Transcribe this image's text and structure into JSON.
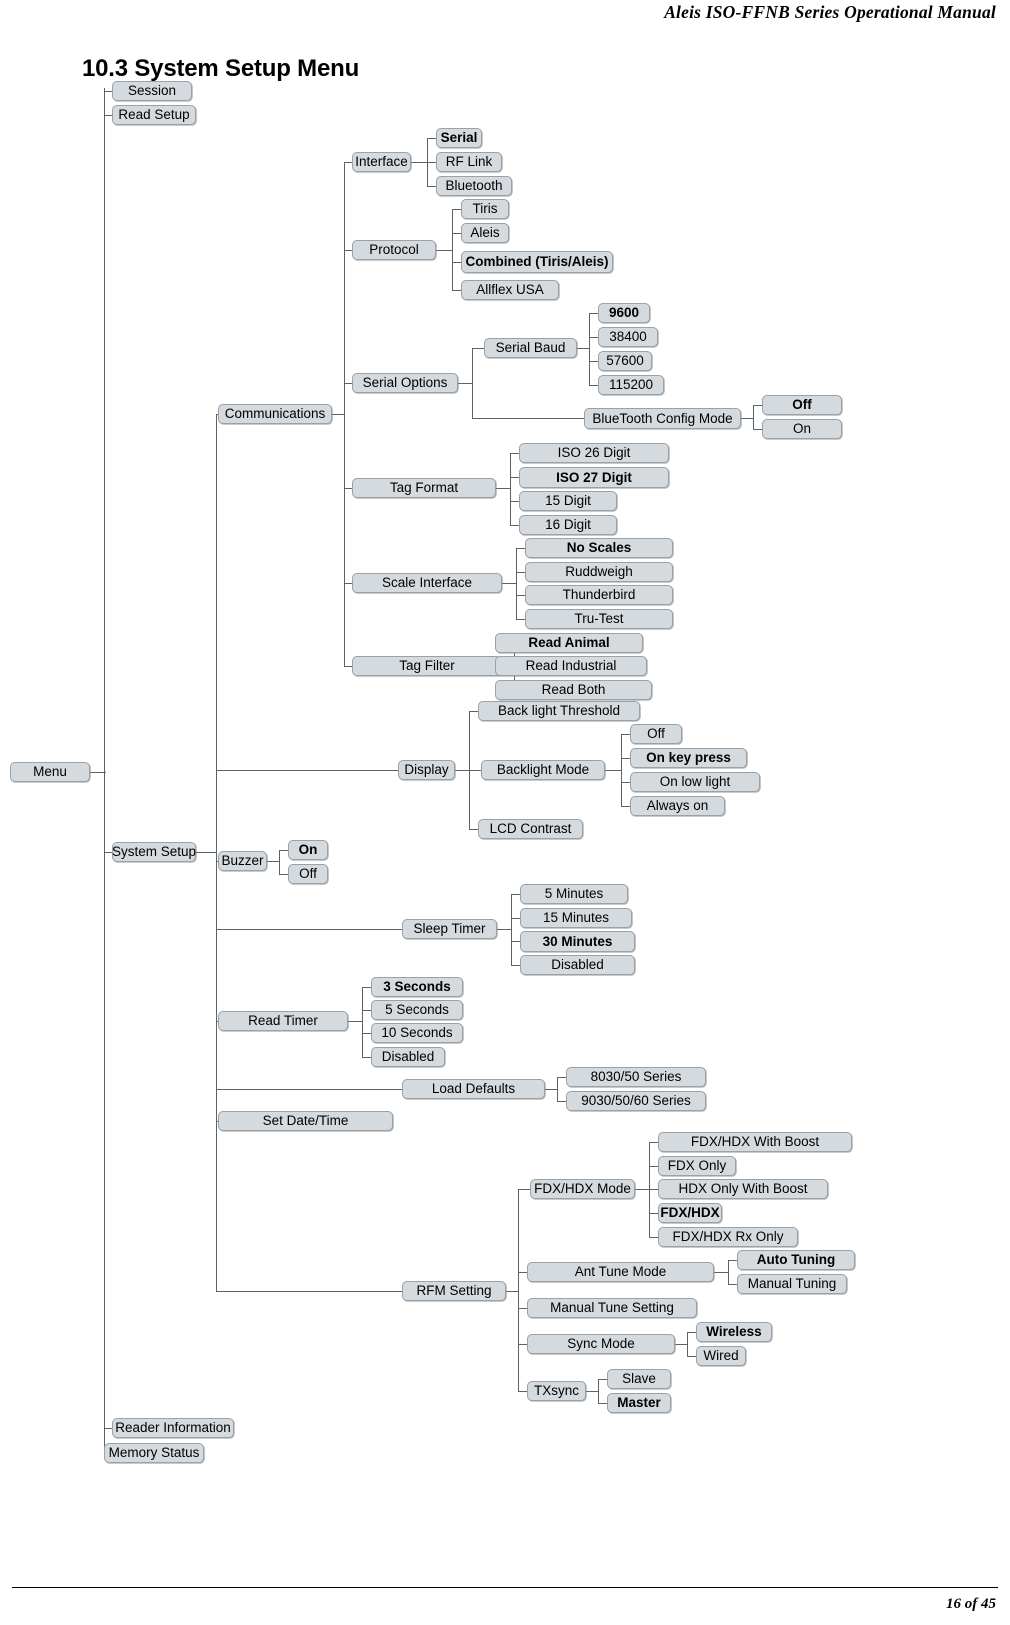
{
  "document": {
    "header_title": "Aleis ISO-FFNB  Series Operational Manual",
    "footer_page": "16 of 45",
    "section_title": "10.3 System Setup Menu"
  },
  "nodes": {
    "menu": {
      "label": "Menu"
    },
    "session": {
      "label": "Session"
    },
    "read_setup": {
      "label": "Read Setup"
    },
    "system_setup": {
      "label": "System Setup"
    },
    "reader_information": {
      "label": "Reader Information"
    },
    "memory_status": {
      "label": "Memory Status"
    },
    "communications": {
      "label": "Communications"
    },
    "interface": {
      "label": "Interface"
    },
    "interface_serial": {
      "label": "Serial",
      "selected": true
    },
    "interface_rf_link": {
      "label": "RF Link"
    },
    "interface_bluetooth": {
      "label": "Bluetooth"
    },
    "protocol": {
      "label": "Protocol"
    },
    "protocol_tiris": {
      "label": "Tiris"
    },
    "protocol_aleis": {
      "label": "Aleis"
    },
    "protocol_combined": {
      "label": "Combined (Tiris/Aleis)",
      "selected": true
    },
    "protocol_allflex": {
      "label": "Allflex USA"
    },
    "serial_options": {
      "label": "Serial Options"
    },
    "serial_baud": {
      "label": "Serial Baud"
    },
    "baud_9600": {
      "label": "9600",
      "selected": true
    },
    "baud_38400": {
      "label": "38400"
    },
    "baud_57600": {
      "label": "57600"
    },
    "baud_115200": {
      "label": "115200"
    },
    "bluetooth_config_mode": {
      "label": "BlueTooth Config Mode"
    },
    "bt_off": {
      "label": "Off",
      "selected": true
    },
    "bt_on": {
      "label": "On"
    },
    "tag_format": {
      "label": "Tag Format"
    },
    "tf_iso26": {
      "label": "ISO 26 Digit"
    },
    "tf_iso27": {
      "label": "ISO 27 Digit",
      "selected": true
    },
    "tf_15": {
      "label": "15 Digit"
    },
    "tf_16": {
      "label": "16 Digit"
    },
    "scale_interface": {
      "label": "Scale Interface"
    },
    "si_no_scales": {
      "label": "No Scales",
      "selected": true
    },
    "si_ruddweigh": {
      "label": "Ruddweigh"
    },
    "si_thunderbird": {
      "label": "Thunderbird"
    },
    "si_tru_test": {
      "label": "Tru-Test"
    },
    "tag_filter": {
      "label": "Tag Filter"
    },
    "tfil_read_animal": {
      "label": "Read Animal",
      "selected": true
    },
    "tfil_read_industrial": {
      "label": "Read Industrial"
    },
    "tfil_read_both": {
      "label": "Read Both"
    },
    "display": {
      "label": "Display"
    },
    "backlight_threshold": {
      "label": "Back light Threshold"
    },
    "backlight_mode": {
      "label": "Backlight Mode"
    },
    "bl_off": {
      "label": "Off"
    },
    "bl_on_key_press": {
      "label": "On key press",
      "selected": true
    },
    "bl_on_low_light": {
      "label": "On low light"
    },
    "bl_always_on": {
      "label": "Always on"
    },
    "lcd_contrast": {
      "label": "LCD Contrast"
    },
    "buzzer": {
      "label": "Buzzer"
    },
    "buzzer_on": {
      "label": "On",
      "selected": true
    },
    "buzzer_off": {
      "label": "Off"
    },
    "sleep_timer": {
      "label": "Sleep Timer"
    },
    "sleep_5": {
      "label": "5 Minutes"
    },
    "sleep_15": {
      "label": "15 Minutes"
    },
    "sleep_30": {
      "label": "30 Minutes",
      "selected": true
    },
    "sleep_disabled": {
      "label": "Disabled"
    },
    "read_timer": {
      "label": "Read Timer"
    },
    "rt_3s": {
      "label": "3 Seconds",
      "selected": true
    },
    "rt_5s": {
      "label": "5 Seconds"
    },
    "rt_10s": {
      "label": "10 Seconds"
    },
    "rt_disabled": {
      "label": "Disabled"
    },
    "load_defaults": {
      "label": "Load Defaults"
    },
    "ld_8030": {
      "label": "8030/50 Series"
    },
    "ld_9030": {
      "label": "9030/50/60 Series"
    },
    "set_date_time": {
      "label": "Set Date/Time"
    },
    "rfm_setting": {
      "label": "RFM Setting"
    },
    "fdx_hdx_mode": {
      "label": "FDX/HDX Mode"
    },
    "fh_with_boost": {
      "label": "FDX/HDX With Boost"
    },
    "fh_fdx_only": {
      "label": "FDX Only"
    },
    "fh_hdx_boost": {
      "label": "HDX Only With Boost"
    },
    "fh_fdxhdx": {
      "label": "FDX/HDX",
      "selected": true
    },
    "fh_rx_only": {
      "label": "FDX/HDX Rx Only"
    },
    "ant_tune_mode": {
      "label": "Ant Tune Mode"
    },
    "atm_auto": {
      "label": "Auto Tuning",
      "selected": true
    },
    "atm_manual": {
      "label": "Manual Tuning"
    },
    "manual_tune_setting": {
      "label": "Manual Tune Setting"
    },
    "sync_mode": {
      "label": "Sync  Mode"
    },
    "sync_wireless": {
      "label": "Wireless",
      "selected": true
    },
    "sync_wired": {
      "label": "Wired"
    },
    "txsync": {
      "label": "TXsync"
    },
    "tx_slave": {
      "label": "Slave"
    },
    "tx_master": {
      "label": "Master",
      "selected": true
    }
  },
  "colors": {
    "node_fill": "#d5dade",
    "node_border": "#9aa1a7",
    "connector": "#5d6266",
    "text": "#000000",
    "page_background": "#ffffff"
  }
}
